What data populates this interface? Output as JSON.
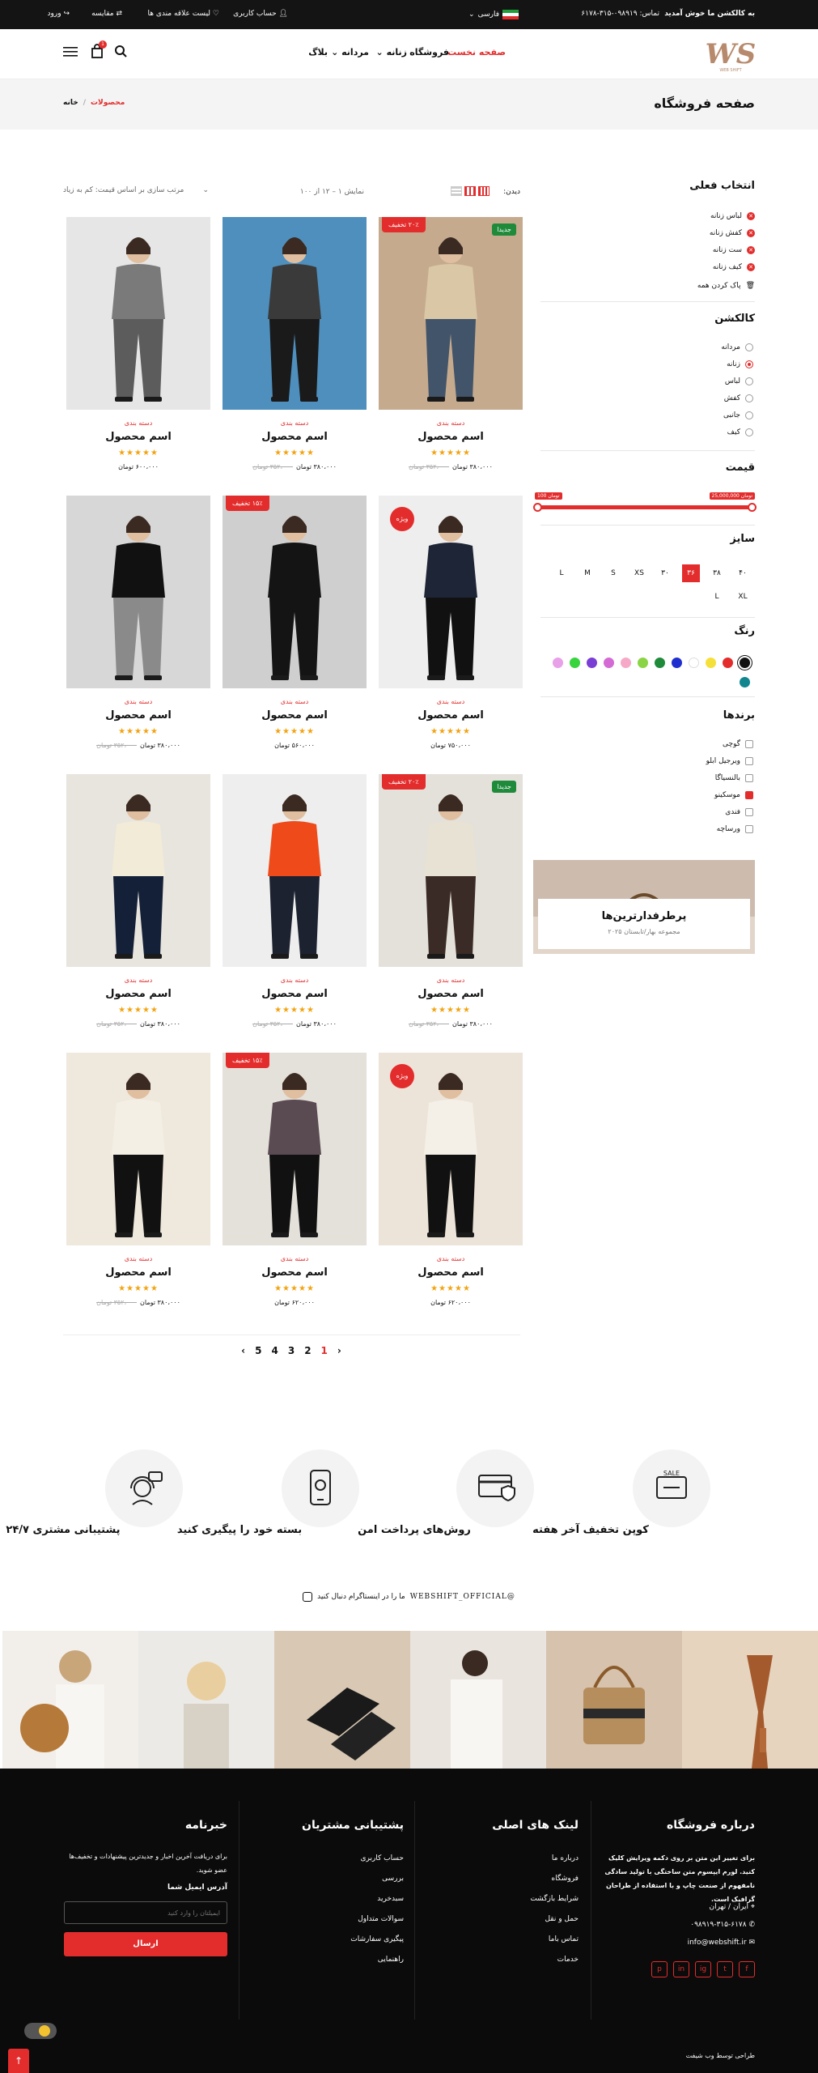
{
  "topbar": {
    "welcome": "به کالکشن ما خوش آمدید",
    "phone": "تماس: ۰۹۸۹۱۹-۳۱۵-۶۱۷۸",
    "language": "فارسی",
    "account": "حساب کاربری",
    "wishlist": "لیست علاقه مندی ها",
    "compare": "مقایسه",
    "login": "ورود"
  },
  "header": {
    "logo": "WS",
    "nav": [
      "صفحه نخست",
      "فروشگاه",
      "زنانه",
      "مردانه",
      "بلاگ"
    ],
    "cart_count": "1"
  },
  "titleband": {
    "title": "صفحه فروشگاه",
    "breadcrumb_home": "خانه",
    "breadcrumb_sep": "/",
    "breadcrumb_current": "محصولات"
  },
  "toolbar": {
    "view_label": "دیدن:",
    "showing": "نمایش ۱ – ۱۲ از ۱۰۰",
    "sort": "مرتب سازی بر اساس قیمت: کم به زیاد"
  },
  "sidebar": {
    "current_title": "انتخاب فعلی",
    "current_chips": [
      "لباس زنانه",
      "کفش زنانه",
      "ست زنانه",
      "کیف زنانه"
    ],
    "clear_all": "پاک کردن همه",
    "collection_title": "کالکشن",
    "collections": [
      "مردانه",
      "زنانه",
      "لباس",
      "کفش",
      "جانبی",
      "کیف"
    ],
    "collection_selected": 1,
    "price_title": "قیمت",
    "price_max": "تومان 25,000,000",
    "price_min": "تومان 100",
    "size_title": "سایز",
    "sizes_row1": [
      "۴۰",
      "۳۸",
      "۳۶",
      "۳۰",
      "XS",
      "S",
      "M",
      "L"
    ],
    "sizes_row2": [
      "XL",
      "L"
    ],
    "size_selected": "۳۶",
    "color_title": "رنگ",
    "colors": [
      "#111111",
      "#e32d2d",
      "#f5e03a",
      "#ffffff",
      "#1f2fcf",
      "#1e8a3a",
      "#8bd446",
      "#f6a9c6",
      "#d46ad4",
      "#7a3ed4",
      "#37d43e",
      "#e8a0e8",
      "#11868e"
    ],
    "brand_title": "برندها",
    "brands": [
      "گوچی",
      "ویرجیل ابلو",
      "بالنسیاگا",
      "موسکینو",
      "فندی",
      "ورساچه"
    ],
    "brand_selected": 3,
    "promo_title": "پرطرفدارترین‌ها",
    "promo_sub": "مجموعه بهار/تابستان ۲۰۲۵"
  },
  "products": [
    {
      "badge_left": "۲۰٪ تخفیف",
      "badge_right": "جدیدا",
      "category": "دسته بندی",
      "name": "اسم محصول",
      "stars": "★★★★★",
      "price": "۳۸۰،۰۰۰ تومان",
      "old": "۳۵۲،۰۰۰ تومان",
      "bg": "#c5aa8e",
      "top": "#d9c7a6",
      "bottom": "#41546a"
    },
    {
      "badge_left": "",
      "badge_right": "",
      "category": "دسته بندی",
      "name": "اسم محصول",
      "stars": "★★★★★",
      "price": "۳۸۰،۰۰۰ تومان",
      "old": "۳۵۲،۰۰۰ تومان",
      "bg": "#4f8fbd",
      "top": "#3a3a3a",
      "bottom": "#1a1a1a"
    },
    {
      "badge_left": "",
      "badge_right": "",
      "category": "دسته بندی",
      "name": "اسم محصول",
      "stars": "★★★★★",
      "price": "۶۰۰،۰۰۰ تومان",
      "old": "",
      "bg": "#e6e6e6",
      "top": "#7a7a7a",
      "bottom": "#5c5c5c"
    },
    {
      "badge_left": "ویژه",
      "badge_right": "",
      "category": "دسته بندی",
      "name": "اسم محصول",
      "stars": "★★★★★",
      "price": "۷۵۰،۰۰۰ تومان",
      "old": "",
      "bg": "#eeeeee",
      "top": "#1e2536",
      "bottom": "#111111"
    },
    {
      "badge_left": "۱۵٪ تخفیف",
      "badge_right": "",
      "category": "دسته بندی",
      "name": "اسم محصول",
      "stars": "★★★★★",
      "price": "۵۶۰،۰۰۰ تومان",
      "old": "",
      "bg": "#cfcfcf",
      "top": "#141414",
      "bottom": "#141414"
    },
    {
      "badge_left": "",
      "badge_right": "",
      "category": "دسته بندی",
      "name": "اسم محصول",
      "stars": "★★★★★",
      "price": "۳۸۰،۰۰۰ تومان",
      "old": "۳۵۲،۰۰۰ تومان",
      "bg": "#d7d7d7",
      "top": "#111111",
      "bottom": "#8a8a8a"
    },
    {
      "badge_left": "۲۰٪ تخفیف",
      "badge_right": "جدیدا",
      "category": "دسته بندی",
      "name": "اسم محصول",
      "stars": "★★★★★",
      "price": "۳۸۰،۰۰۰ تومان",
      "old": "۳۵۲،۰۰۰ تومان",
      "bg": "#e4e0da",
      "top": "#e8e2d4",
      "bottom": "#3b2b26"
    },
    {
      "badge_left": "",
      "badge_right": "",
      "category": "دسته بندی",
      "name": "اسم محصول",
      "stars": "★★★★★",
      "price": "۳۸۰،۰۰۰ تومان",
      "old": "۳۵۲،۰۰۰ تومان",
      "bg": "#eeeeee",
      "top": "#ee4a1a",
      "bottom": "#1c2230"
    },
    {
      "badge_left": "",
      "badge_right": "",
      "category": "دسته بندی",
      "name": "اسم محصول",
      "stars": "★★★★★",
      "price": "۳۸۰،۰۰۰ تومان",
      "old": "۳۵۲،۰۰۰ تومان",
      "bg": "#e8e4de",
      "top": "#f1ebd8",
      "bottom": "#142038"
    },
    {
      "badge_left": "ویژه",
      "badge_right": "",
      "category": "دسته بندی",
      "name": "اسم محصول",
      "stars": "★★★★★",
      "price": "۶۲۰،۰۰۰ تومان",
      "old": "",
      "bg": "#ece4d8",
      "top": "#f4f0e8",
      "bottom": "#111111"
    },
    {
      "badge_left": "۱۵٪ تخفیف",
      "badge_right": "",
      "category": "دسته بندی",
      "name": "اسم محصول",
      "stars": "★★★★★",
      "price": "۶۲۰،۰۰۰ تومان",
      "old": "",
      "bg": "#e4e0da",
      "top": "#5a4a52",
      "bottom": "#111111"
    },
    {
      "badge_left": "",
      "badge_right": "",
      "category": "دسته بندی",
      "name": "اسم محصول",
      "stars": "★★★★★",
      "price": "۳۸۰،۰۰۰ تومان",
      "old": "۳۵۲،۰۰۰ تومان",
      "bg": "#efe8dd",
      "top": "#f4efe4",
      "bottom": "#111111"
    }
  ],
  "pagination": {
    "pages": [
      "1",
      "2",
      "3",
      "4",
      "5"
    ],
    "current": "1",
    "prev": "‹",
    "next": "›"
  },
  "features": [
    {
      "label": "کوپن تخفیف آخر هفته"
    },
    {
      "label": "روش‌های پرداخت امن"
    },
    {
      "label": "بسته خود را پیگیری کنید"
    },
    {
      "label": "پشتیبانی مشتری ۲۴/۷"
    }
  ],
  "instagram": {
    "text": "ما را در اینستاگرام دنبال کنید",
    "handle": "@WEBSHIFT_OFFICIAL"
  },
  "footer": {
    "about_title": "درباره فروشگاه",
    "about_text": "برای تغییر این متن بر روی دکمه ویرایش کلیک کنید. لورم ایپسوم متن ساختگی با تولید سادگی نامفهوم از صنعت چاپ و با استفاده از طراحان گرافیک است.",
    "address": "ایران / تهران",
    "phone": "۰۹۸۹۱۹-۳۱۵-۶۱۷۸",
    "email": "info@webshift.ir",
    "links_title": "لینک های اصلی",
    "links": [
      "درباره ما",
      "فروشگاه",
      "شرایط بازگشت",
      "حمل و نقل",
      "تماس باما",
      "خدمات"
    ],
    "support_title": "پشتیبانی مشتریان",
    "support": [
      "حساب کاربری",
      "بررسی",
      "سبدخرید",
      "سوالات متداول",
      "پیگیری سفارشات",
      "راهنمایی"
    ],
    "newsletter_title": "خبرنامه",
    "newsletter_text": "برای دریافت آخرین اخبار و جدیدترین پیشنهادات و تخفیف‌ها عضو شوید.",
    "newsletter_label": "آدرس ایمیل شما",
    "newsletter_placeholder": "ایمیلتان را وارد کنید",
    "newsletter_button": "ارسال",
    "credit": "طراحی توسط وب شیفت",
    "socials": [
      "f",
      "t",
      "ig",
      "in",
      "p"
    ]
  }
}
